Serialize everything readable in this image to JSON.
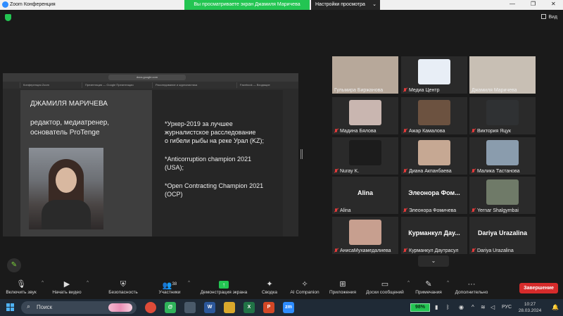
{
  "window": {
    "title": "Zoom Конференция",
    "share_banner": "Вы просматриваете экран Джамиля Маричева",
    "view_settings": "Настройки просмотра",
    "view_label": "Вид"
  },
  "shared_slide": {
    "url": "docs.google.com",
    "tabs": [
      "Конференция Zoom",
      "Презентация — Google Презентации",
      "Расследование и журналистика",
      "Facebook — Входящие"
    ],
    "name": "ДЖАМИЛЯ МАРИЧЕВА",
    "role_line1": "редактор, медиатренер,",
    "role_line2": "основатель ProTenge",
    "award1_line1": "*Уркер-2019 за лучшее",
    "award1_line2": "журналистское расследование",
    "award1_line3": "о гибели рыбы на реке Урал (KZ);",
    "award2_line1": "*Anticorruption champion 2021",
    "award2_line2": "(USA);",
    "award3_line1": "*Open Contracting Champion 2021",
    "award3_line2": "(OCP)"
  },
  "participants": [
    {
      "name": "Гульмира   Биржанова",
      "muted": false,
      "video": true,
      "color": "#b7a89a"
    },
    {
      "name": "Медиа Центр",
      "muted": true,
      "video": true,
      "color": "#e8eef6"
    },
    {
      "name": "Джамиля Маричева",
      "muted": false,
      "video": true,
      "color": "#c8bfb4"
    },
    {
      "name": "Мадина Бялова",
      "muted": true,
      "video": true,
      "color": "#c9b6b0"
    },
    {
      "name": "Ажар Камалова",
      "muted": true,
      "video": true,
      "color": "#6c5240"
    },
    {
      "name": "Виктория Яцук",
      "muted": true,
      "video": true,
      "color": "#2f3133"
    },
    {
      "name": "Nuray K.",
      "muted": true,
      "video": true,
      "color": "#1c1c1c"
    },
    {
      "name": "Диана Акпанбаева",
      "muted": true,
      "video": true,
      "color": "#c6a893"
    },
    {
      "name": "Малика Тастанова",
      "muted": true,
      "video": true,
      "color": "#8a9cad"
    },
    {
      "name": "Alina",
      "muted": true,
      "video": false,
      "label": "Alina"
    },
    {
      "name": "Элеонора Фомичева",
      "muted": true,
      "video": false,
      "label": "Элеонора  Фом..."
    },
    {
      "name": "Yernar Shalgymbai",
      "muted": true,
      "video": true,
      "color": "#6f7a68"
    },
    {
      "name": "АнисаМухамедалиева",
      "muted": true,
      "video": true,
      "color": "#c79f8f"
    },
    {
      "name": "Курманкул Даутрасул",
      "muted": true,
      "video": false,
      "label": "Курманкул  Дау..."
    },
    {
      "name": "Dariya Urazalina",
      "muted": true,
      "video": false,
      "label": "Dariya Urazalina"
    }
  ],
  "toolbar": {
    "unmute": "Включить звук",
    "start_video": "Начать видео",
    "security": "Безопасность",
    "participants": "Участники",
    "participants_count": "38",
    "share": "Демонстрация экрана",
    "summary": "Сводка",
    "ai_companion": "AI Companion",
    "apps": "Приложения",
    "whiteboards": "Доски сообщений",
    "notes": "Примечания",
    "more": "Дополнительно",
    "leave": "Завершение"
  },
  "taskbar": {
    "search": "Поиск",
    "battery": "98%",
    "lang": "РУС",
    "time": "10:27",
    "date": "28.03.2024"
  }
}
